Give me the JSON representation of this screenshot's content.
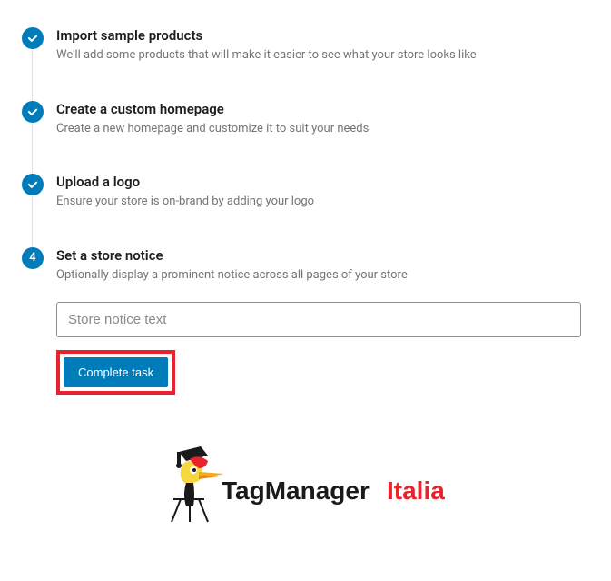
{
  "steps": {
    "s1": {
      "title": "Import sample products",
      "desc": "We'll add some products that will make it easier to see what your store looks like"
    },
    "s2": {
      "title": "Create a custom homepage",
      "desc": "Create a new homepage and customize it to suit your needs"
    },
    "s3": {
      "title": "Upload a logo",
      "desc": "Ensure your store is on-brand by adding your logo"
    },
    "s4": {
      "number": "4",
      "title": "Set a store notice",
      "desc": "Optionally display a prominent notice across all pages of your store",
      "placeholder": "Store notice text",
      "button": "Complete task"
    }
  },
  "logo": {
    "text1": "TagManager",
    "text2": "Italia"
  }
}
